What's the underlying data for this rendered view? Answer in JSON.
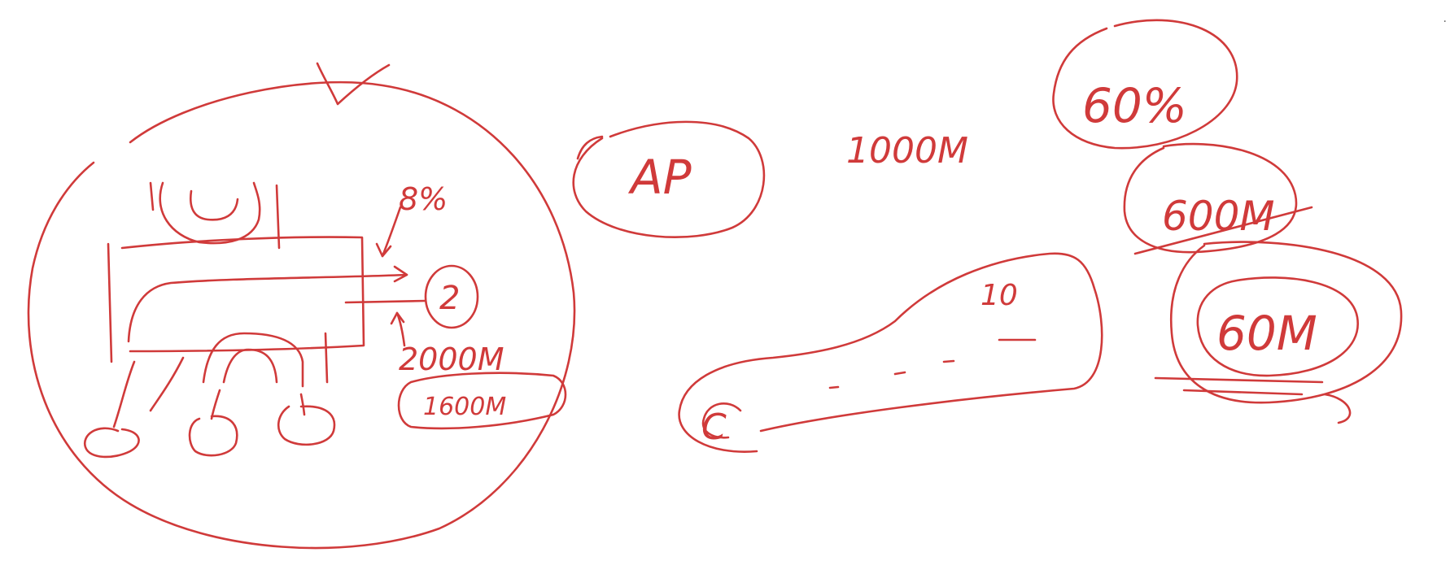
{
  "ink_color": "#d03a3a",
  "labels": {
    "label_80pct": "8%",
    "label_2": "2",
    "label_2000m": "2000M",
    "label_1600m": "1600M",
    "label_ap": "AP",
    "label_1000m": "1000M",
    "label_10": "10",
    "label_c": "C",
    "label_60pct": "60%",
    "label_600m": "600M",
    "label_60m": "60M"
  }
}
